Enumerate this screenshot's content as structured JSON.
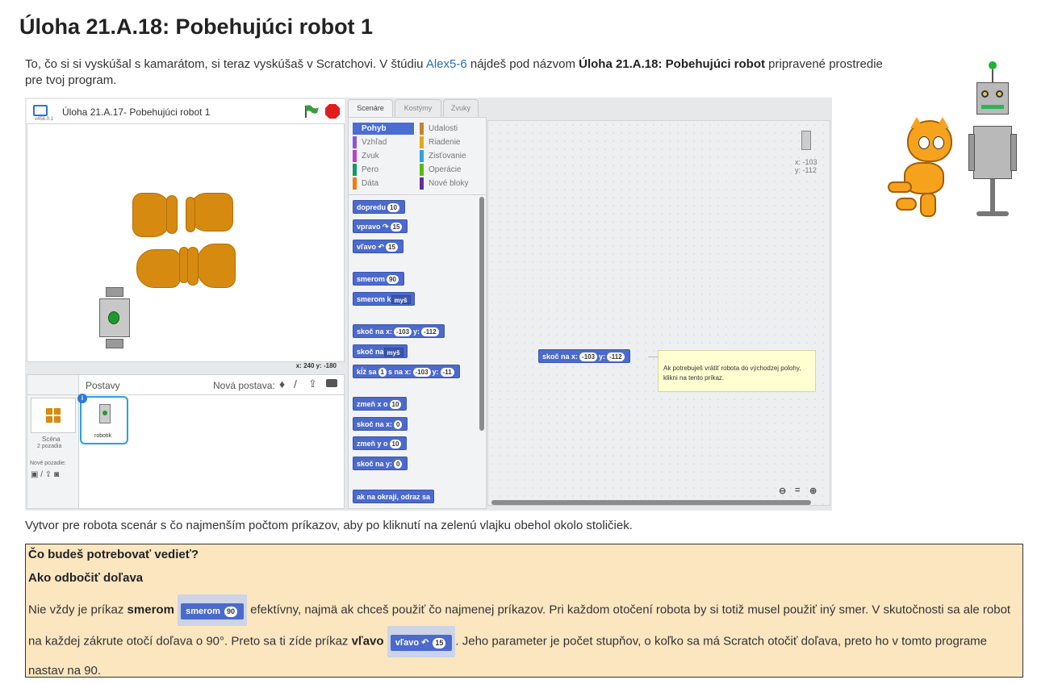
{
  "title": "Úloha 21.A.18: Pobehujúci robot 1",
  "intro": {
    "t1": "To, čo si si vyskúšal s kamarátom, si teraz vyskúšaš v Scratchovi. V štúdiu ",
    "link": "Alex5-6",
    "t2": " nájdeš pod názvom ",
    "bold": "Úloha 21.A.18: Pobehujúci robot",
    "t3": " pripravené prostredie pre tvoj program."
  },
  "editor": {
    "project_title": "Úloha 21.A.17- Pobehujúci robot 1",
    "version": "v456.0.1",
    "coords": "x: 240  y: -180",
    "tabs": [
      "Scenáre",
      "Kostýmy",
      "Zvuky"
    ],
    "categories_left": [
      "Pohyb",
      "Vzhľad",
      "Zvuk",
      "Pero",
      "Dáta"
    ],
    "categories_right": [
      "Udalosti",
      "Riadenie",
      "Zisťovanie",
      "Operácie",
      "Nové bloky"
    ],
    "cat_colors": [
      "#4a6cd4",
      "#8a55d7",
      "#bb42c3",
      "#0e9a6c",
      "#ee7d16",
      "#c88330",
      "#e1a91a",
      "#2ca5e2",
      "#5cb712",
      "#632d99"
    ],
    "blocks": {
      "b1": "dopredu",
      "b1v": "10",
      "b2": "vpravo",
      "b2v": "15",
      "b3": "vľavo",
      "b3v": "15",
      "b4": "smerom",
      "b4v": "90",
      "b5": "smerom k",
      "b5v": "myš",
      "b6": "skoč na x:",
      "b6x": "-103",
      "b6y": "-112",
      "b7": "skoč na",
      "b7v": "myš",
      "b8": "kĺž sa",
      "b8a": "1",
      "b8b": "s na x:",
      "b8x": "-103",
      "b8y": "-11",
      "b9": "zmeň x o",
      "b9v": "10",
      "b10": "skoč na x:",
      "b10v": "0",
      "b11": "zmeň y o",
      "b11v": "10",
      "b12": "skoč na y:",
      "b12v": "0",
      "b13": "ak na okraji, odraz sa",
      "ylabel": "y:"
    },
    "script_block": {
      "label": "skoč na x:",
      "x": "-103",
      "ylabel": "y:",
      "y": "-112"
    },
    "note": "Ak potrebuješ vrátiť robota do východzej polohy, klikni na tento príkaz.",
    "sprite_pos": {
      "x": "x: -103",
      "y": "y: -112"
    },
    "sprites_label": "Postavy",
    "new_sprite": "Nová postava:",
    "scene_label": "Scéna",
    "scene_sub": "2 pozadia",
    "new_backdrop": "Nové pozadie:",
    "sprite_name": "robotik"
  },
  "task": "Vytvor pre robota scenár s čo najmenším počtom príkazov, aby po kliknutí na zelenú vlajku obehol okolo stoličiek.",
  "info": {
    "heading": "Čo budeš potrebovať vedieť?",
    "sub": "Ako odbočiť doľava",
    "p1": "Nie vždy je príkaz ",
    "p1b": "smerom",
    "blk1": "smerom",
    "blk1v": "90",
    "p2": " efektívny, najmä ak chceš použiť čo najmenej príkazov. Pri každom otočení robota by si totiž musel použiť iný smer. V skutočnosti sa ale robot na každej zákrute otočí doľava o 90°. Preto sa ti zíde príkaz ",
    "p2b": "vľavo",
    "blk2": "vľavo",
    "blk2v": "15",
    "p3": ". Jeho parameter je počet stupňov, o koľko sa má Scratch otočiť doľava, preto ho v tomto programe nastav na 90."
  }
}
